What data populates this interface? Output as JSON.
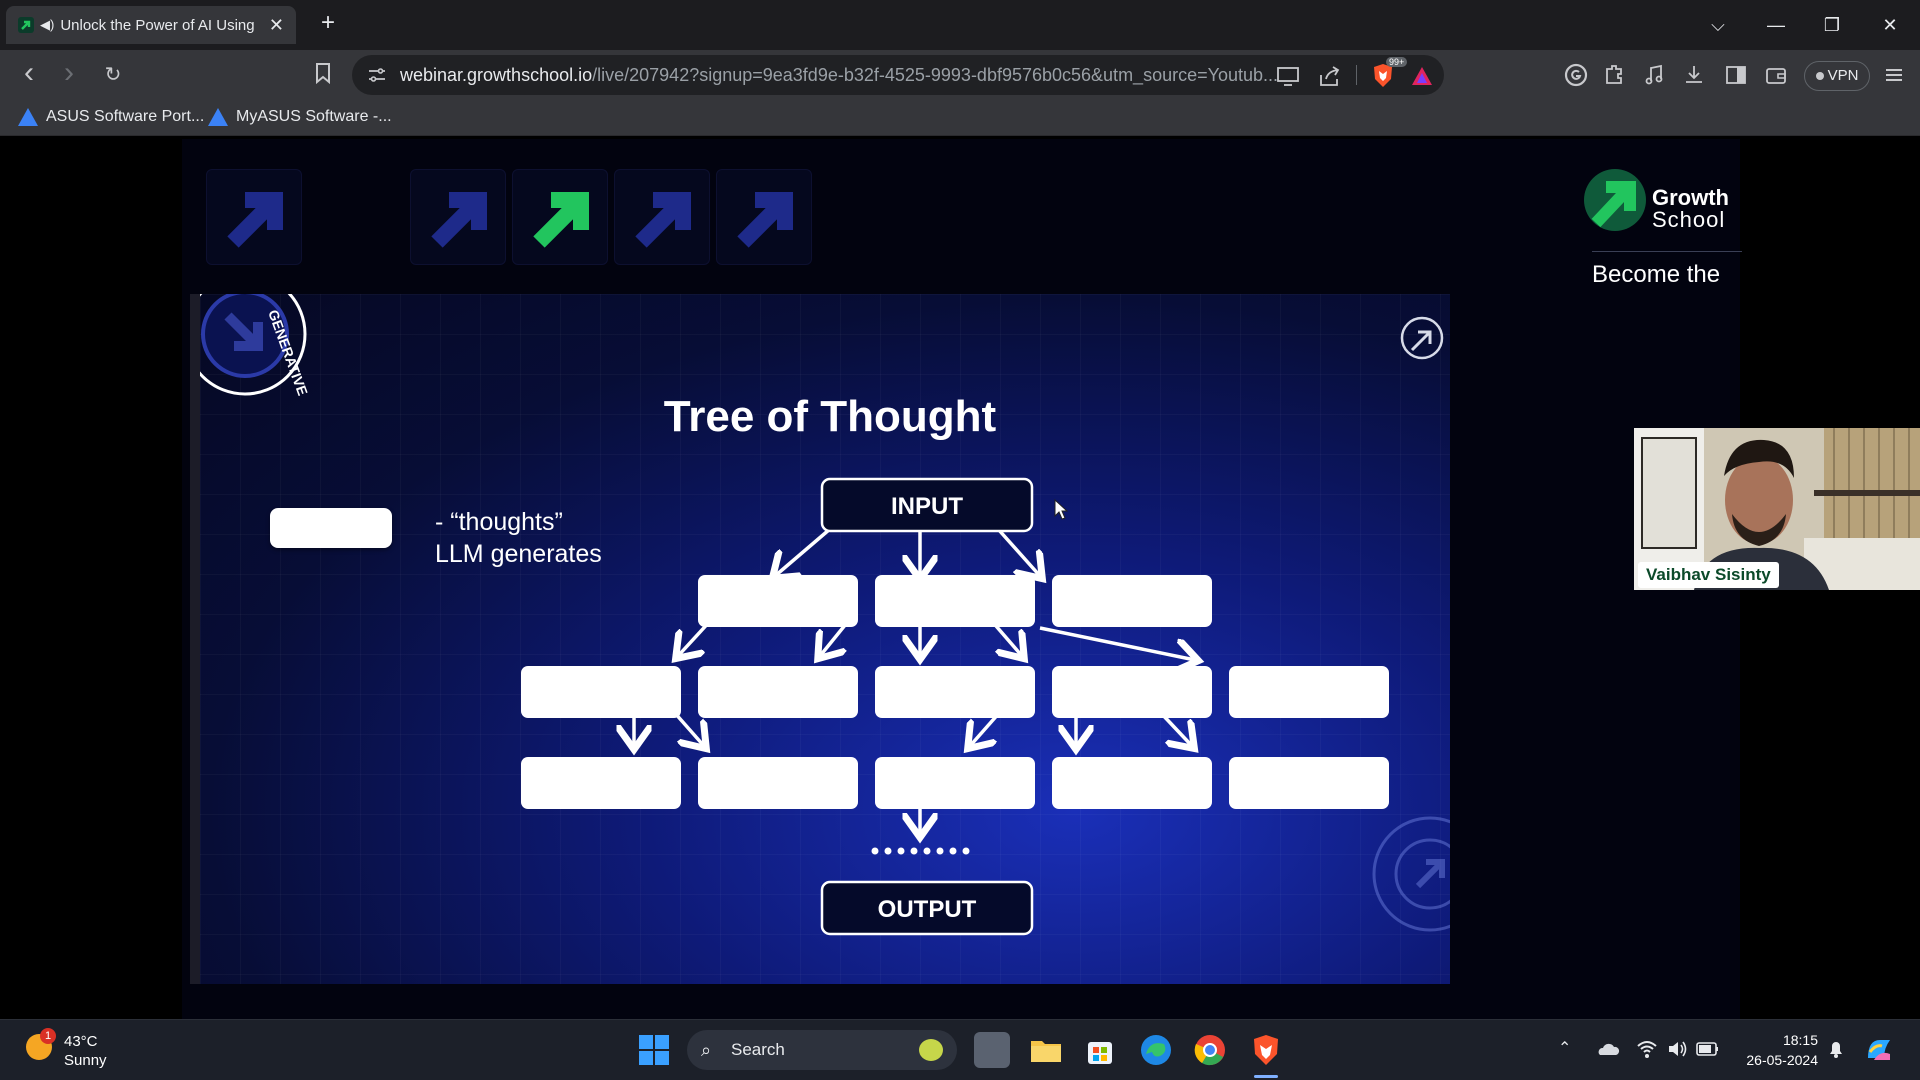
{
  "browser": {
    "tab": {
      "title": "Unlock the Power of AI Using",
      "close": "✕"
    },
    "new_tab": "+",
    "window_controls": {
      "list": "⌵",
      "minimize": "—",
      "restore": "❐",
      "close": "✕"
    },
    "nav": {
      "back": "‹",
      "forward": "›",
      "reload": "↻",
      "bookmark": "☐"
    },
    "url": {
      "host": "webinar.growthschool.io",
      "path": "/live/207942?signup=9ea3fd9e-b32f-4525-9993-dbf9576b0c56&utm_source=Youtub..."
    },
    "shields_badge": "99+",
    "vpn_label": "VPN",
    "bookmarks": [
      {
        "label": "ASUS Software Port..."
      },
      {
        "label": "MyASUS Software -..."
      }
    ]
  },
  "page": {
    "brand": {
      "line1": "Growth",
      "line2": "School",
      "tagline": "Become the"
    },
    "slide": {
      "title": "Tree of Thought",
      "legend_text_line1": "- “thoughts”",
      "legend_text_line2": "LLM generates",
      "input_label": "INPUT",
      "output_label": "OUTPUT",
      "badge_generative": "GENERATIVE AI",
      "badge_progressive": "PROGR ... ENERATIVE AI"
    },
    "webcam": {
      "speaker_name": "Vaibhav Sisinty"
    }
  },
  "taskbar": {
    "weather": {
      "temperature": "43°C",
      "condition": "Sunny",
      "notification_count": "1"
    },
    "search_label": "Search",
    "clock": {
      "time": "18:15",
      "date": "26-05-2024"
    }
  },
  "colors": {
    "brand_green": "#22c55e",
    "slide_blue": "#0e1a78",
    "arrow_navy": "#1e2a8a"
  }
}
